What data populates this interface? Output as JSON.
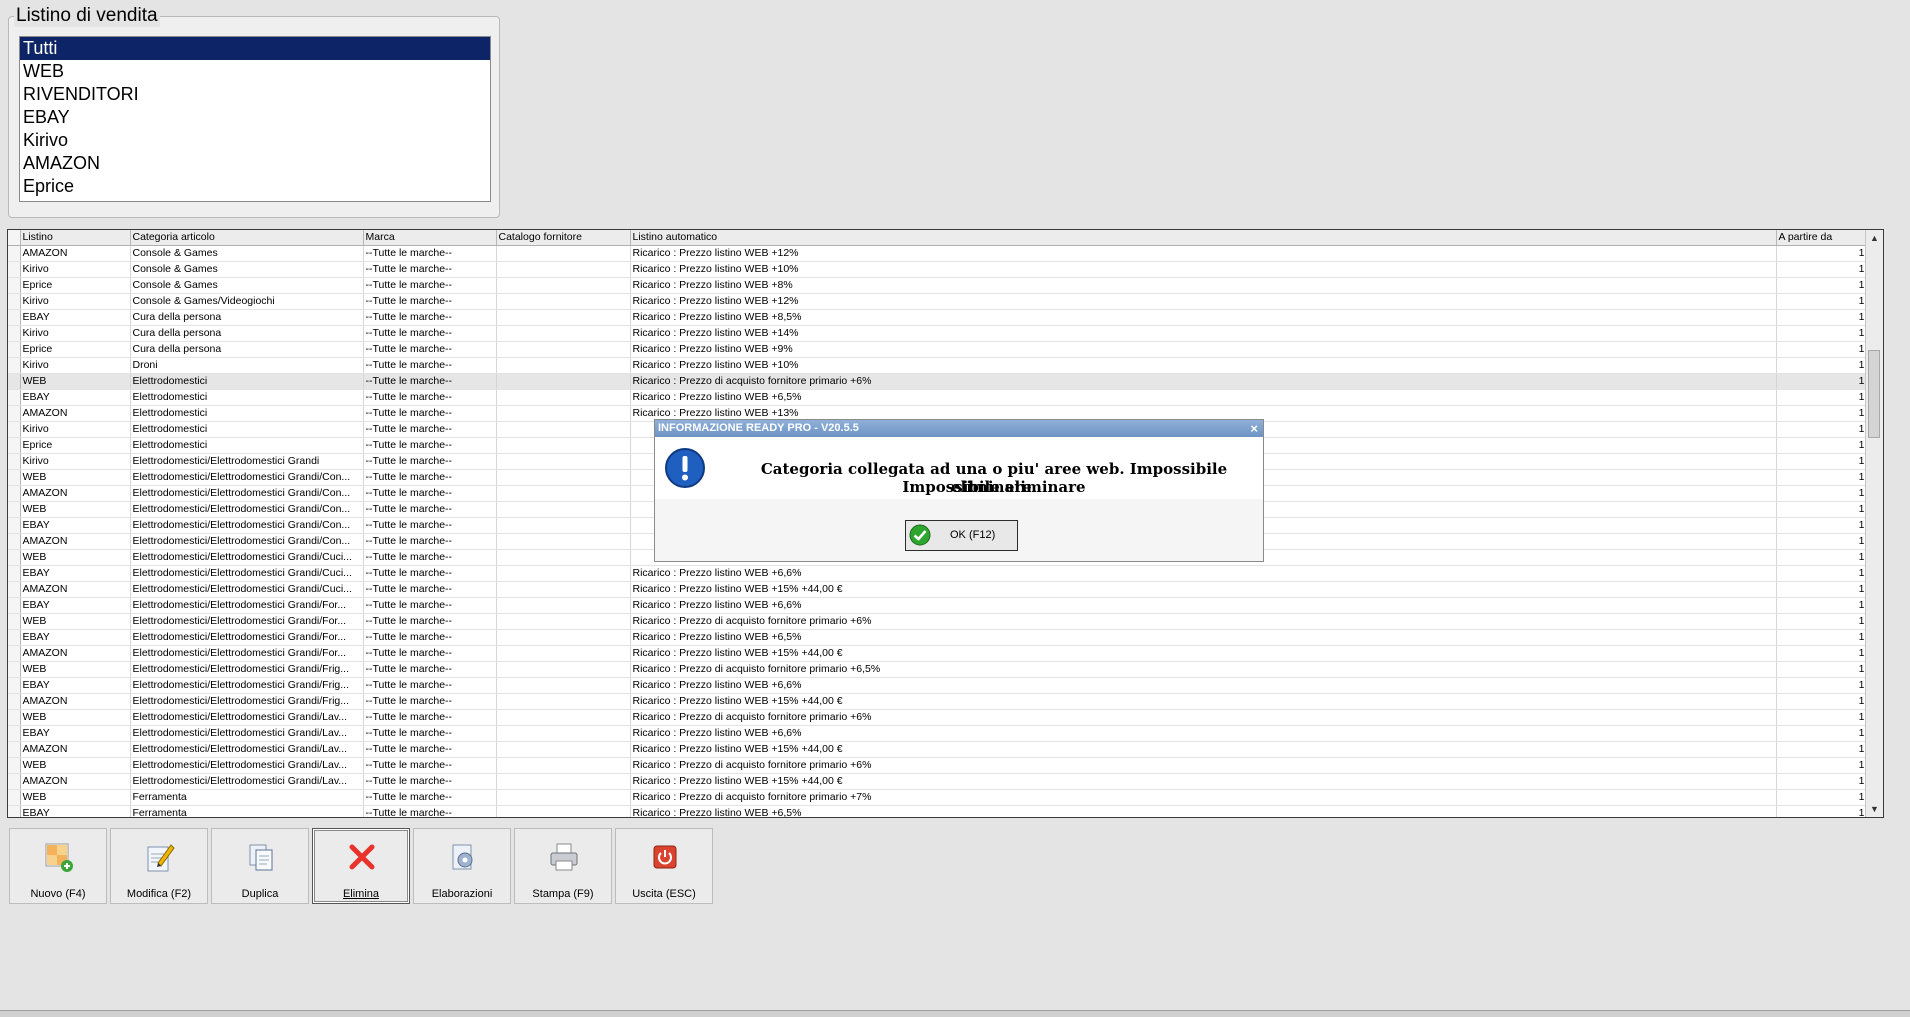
{
  "group": {
    "title": "Listino di vendita",
    "items": [
      "Tutti",
      "WEB",
      "RIVENDITORI",
      "EBAY",
      "Kirivo",
      "AMAZON",
      "Eprice"
    ],
    "selected_index": 0
  },
  "grid": {
    "columns": [
      "Listino",
      "Categoria articolo",
      "Marca",
      "Catalogo fornitore",
      "Listino automatico",
      "A partire da"
    ],
    "highlighted_row": 8,
    "rows": [
      [
        "AMAZON",
        "Console & Games",
        "--Tutte le marche--",
        "",
        "Ricarico : Prezzo listino WEB +12%",
        "1"
      ],
      [
        "Kirivo",
        "Console & Games",
        "--Tutte le marche--",
        "",
        "Ricarico : Prezzo listino WEB +10%",
        "1"
      ],
      [
        "Eprice",
        "Console & Games",
        "--Tutte le marche--",
        "",
        "Ricarico : Prezzo listino WEB +8%",
        "1"
      ],
      [
        "Kirivo",
        "Console & Games/Videogiochi",
        "--Tutte le marche--",
        "",
        "Ricarico : Prezzo listino WEB +12%",
        "1"
      ],
      [
        "EBAY",
        "Cura della persona",
        "--Tutte le marche--",
        "",
        "Ricarico : Prezzo listino WEB +8,5%",
        "1"
      ],
      [
        "Kirivo",
        "Cura della persona",
        "--Tutte le marche--",
        "",
        "Ricarico : Prezzo listino WEB +14%",
        "1"
      ],
      [
        "Eprice",
        "Cura della persona",
        "--Tutte le marche--",
        "",
        "Ricarico : Prezzo listino WEB +9%",
        "1"
      ],
      [
        "Kirivo",
        "Droni",
        "--Tutte le marche--",
        "",
        "Ricarico : Prezzo listino WEB +10%",
        "1"
      ],
      [
        "WEB",
        "Elettrodomestici",
        "--Tutte le marche--",
        "",
        "Ricarico : Prezzo di acquisto fornitore primario +6%",
        "1"
      ],
      [
        "EBAY",
        "Elettrodomestici",
        "--Tutte le marche--",
        "",
        "Ricarico : Prezzo listino WEB +6,5%",
        "1"
      ],
      [
        "AMAZON",
        "Elettrodomestici",
        "--Tutte le marche--",
        "",
        "Ricarico : Prezzo listino WEB +13%",
        "1"
      ],
      [
        "Kirivo",
        "Elettrodomestici",
        "--Tutte le marche--",
        "",
        "",
        "1"
      ],
      [
        "Eprice",
        "Elettrodomestici",
        "--Tutte le marche--",
        "",
        "",
        "1"
      ],
      [
        "Kirivo",
        "Elettrodomestici/Elettrodomestici Grandi",
        "--Tutte le marche--",
        "",
        "",
        "1"
      ],
      [
        "WEB",
        "Elettrodomestici/Elettrodomestici Grandi/Con...",
        "--Tutte le marche--",
        "",
        "",
        "1"
      ],
      [
        "AMAZON",
        "Elettrodomestici/Elettrodomestici Grandi/Con...",
        "--Tutte le marche--",
        "",
        "",
        "1"
      ],
      [
        "WEB",
        "Elettrodomestici/Elettrodomestici Grandi/Con...",
        "--Tutte le marche--",
        "",
        "",
        "1"
      ],
      [
        "EBAY",
        "Elettrodomestici/Elettrodomestici Grandi/Con...",
        "--Tutte le marche--",
        "",
        "",
        "1"
      ],
      [
        "AMAZON",
        "Elettrodomestici/Elettrodomestici Grandi/Con...",
        "--Tutte le marche--",
        "",
        "",
        "1"
      ],
      [
        "WEB",
        "Elettrodomestici/Elettrodomestici Grandi/Cuci...",
        "--Tutte le marche--",
        "",
        "",
        "1"
      ],
      [
        "EBAY",
        "Elettrodomestici/Elettrodomestici Grandi/Cuci...",
        "--Tutte le marche--",
        "",
        "Ricarico : Prezzo listino WEB +6,6%",
        "1"
      ],
      [
        "AMAZON",
        "Elettrodomestici/Elettrodomestici Grandi/Cuci...",
        "--Tutte le marche--",
        "",
        "Ricarico : Prezzo listino WEB +15% +44,00 €",
        "1"
      ],
      [
        "EBAY",
        "Elettrodomestici/Elettrodomestici Grandi/For...",
        "--Tutte le marche--",
        "",
        "Ricarico : Prezzo listino WEB +6,6%",
        "1"
      ],
      [
        "WEB",
        "Elettrodomestici/Elettrodomestici Grandi/For...",
        "--Tutte le marche--",
        "",
        "Ricarico : Prezzo di acquisto fornitore primario +6%",
        "1"
      ],
      [
        "EBAY",
        "Elettrodomestici/Elettrodomestici Grandi/For...",
        "--Tutte le marche--",
        "",
        "Ricarico : Prezzo listino WEB +6,5%",
        "1"
      ],
      [
        "AMAZON",
        "Elettrodomestici/Elettrodomestici Grandi/For...",
        "--Tutte le marche--",
        "",
        "Ricarico : Prezzo listino WEB +15% +44,00 €",
        "1"
      ],
      [
        "WEB",
        "Elettrodomestici/Elettrodomestici Grandi/Frig...",
        "--Tutte le marche--",
        "",
        "Ricarico : Prezzo di acquisto fornitore primario +6,5%",
        "1"
      ],
      [
        "EBAY",
        "Elettrodomestici/Elettrodomestici Grandi/Frig...",
        "--Tutte le marche--",
        "",
        "Ricarico : Prezzo listino WEB +6,6%",
        "1"
      ],
      [
        "AMAZON",
        "Elettrodomestici/Elettrodomestici Grandi/Frig...",
        "--Tutte le marche--",
        "",
        "Ricarico : Prezzo listino WEB +15% +44,00 €",
        "1"
      ],
      [
        "WEB",
        "Elettrodomestici/Elettrodomestici Grandi/Lav...",
        "--Tutte le marche--",
        "",
        "Ricarico : Prezzo di acquisto fornitore primario +6%",
        "1"
      ],
      [
        "EBAY",
        "Elettrodomestici/Elettrodomestici Grandi/Lav...",
        "--Tutte le marche--",
        "",
        "Ricarico : Prezzo listino WEB +6,6%",
        "1"
      ],
      [
        "AMAZON",
        "Elettrodomestici/Elettrodomestici Grandi/Lav...",
        "--Tutte le marche--",
        "",
        "Ricarico : Prezzo listino WEB +15% +44,00 €",
        "1"
      ],
      [
        "WEB",
        "Elettrodomestici/Elettrodomestici Grandi/Lav...",
        "--Tutte le marche--",
        "",
        "Ricarico : Prezzo di acquisto fornitore primario +6%",
        "1"
      ],
      [
        "AMAZON",
        "Elettrodomestici/Elettrodomestici Grandi/Lav...",
        "--Tutte le marche--",
        "",
        "Ricarico : Prezzo listino WEB +15% +44,00 €",
        "1"
      ],
      [
        "WEB",
        "Ferramenta",
        "--Tutte le marche--",
        "",
        "Ricarico : Prezzo di acquisto fornitore primario +7%",
        "1"
      ],
      [
        "EBAY",
        "Ferramenta",
        "--Tutte le marche--",
        "",
        "Ricarico : Prezzo listino WEB +6,5%",
        "1"
      ]
    ]
  },
  "toolbar": {
    "buttons": [
      {
        "label": "Nuovo (F4)",
        "icon": "new-grid-icon"
      },
      {
        "label": "Modifica (F2)",
        "icon": "edit-pencil-icon"
      },
      {
        "label": "Duplica",
        "icon": "duplicate-icon"
      },
      {
        "label": "Elimina",
        "icon": "delete-x-icon"
      },
      {
        "label": "Elaborazioni",
        "icon": "process-gear-icon"
      },
      {
        "label": "Stampa (F9)",
        "icon": "printer-icon"
      },
      {
        "label": "Uscita (ESC)",
        "icon": "exit-power-icon"
      }
    ]
  },
  "dialog": {
    "title": "INFORMAZIONE READY PRO - V20.5.5",
    "close": "×",
    "message_line1": "Categoria collegata ad una o piu' aree web. Impossibile eliminare.",
    "message_line2": "Impossibile eliminare",
    "ok_label": "OK (F12)"
  },
  "colors": {
    "selection": "#0d2466",
    "dialog_title": "#7b9dcb",
    "delete_icon": "#e8322b",
    "ok_icon": "#2ea52e"
  }
}
